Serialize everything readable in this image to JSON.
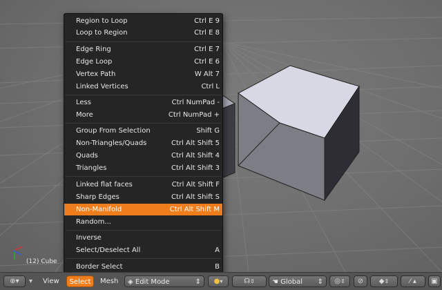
{
  "viewport": {
    "object_label": "(12) Cube"
  },
  "menu": {
    "items": [
      {
        "label": "Region to Loop",
        "shortcut": "Ctrl E 9"
      },
      {
        "label": "Loop to Region",
        "shortcut": "Ctrl E 8"
      },
      {
        "label": "Edge Ring",
        "shortcut": "Ctrl E 7"
      },
      {
        "label": "Edge Loop",
        "shortcut": "Ctrl E 6"
      },
      {
        "label": "Vertex Path",
        "shortcut": "W Alt 7"
      },
      {
        "label": "Linked Vertices",
        "shortcut": "Ctrl L"
      },
      {
        "label": "Less",
        "shortcut": "Ctrl NumPad -"
      },
      {
        "label": "More",
        "shortcut": "Ctrl NumPad +"
      },
      {
        "label": "Group From Selection",
        "shortcut": "Shift G"
      },
      {
        "label": "Non-Triangles/Quads",
        "shortcut": "Ctrl Alt Shift 5"
      },
      {
        "label": "Quads",
        "shortcut": "Ctrl Alt Shift 4"
      },
      {
        "label": "Triangles",
        "shortcut": "Ctrl Alt Shift 3"
      },
      {
        "label": "Linked flat faces",
        "shortcut": "Ctrl Alt Shift F"
      },
      {
        "label": "Sharp Edges",
        "shortcut": "Ctrl Alt Shift S"
      },
      {
        "label": "Non-Manifold",
        "shortcut": "Ctrl Alt Shift M"
      },
      {
        "label": "Random...",
        "shortcut": ""
      },
      {
        "label": "Inverse",
        "shortcut": ""
      },
      {
        "label": "Select/Deselect All",
        "shortcut": "A"
      },
      {
        "label": "Border Select",
        "shortcut": "B"
      }
    ],
    "highlighted": "Non-Manifold"
  },
  "header": {
    "view": "View",
    "select": "Select",
    "mesh": "Mesh",
    "mode": "Edit Mode",
    "orientation": "Global"
  },
  "colors": {
    "accent": "#f07d1c",
    "menu_bg": "#252525",
    "header_bg": "#545454"
  }
}
